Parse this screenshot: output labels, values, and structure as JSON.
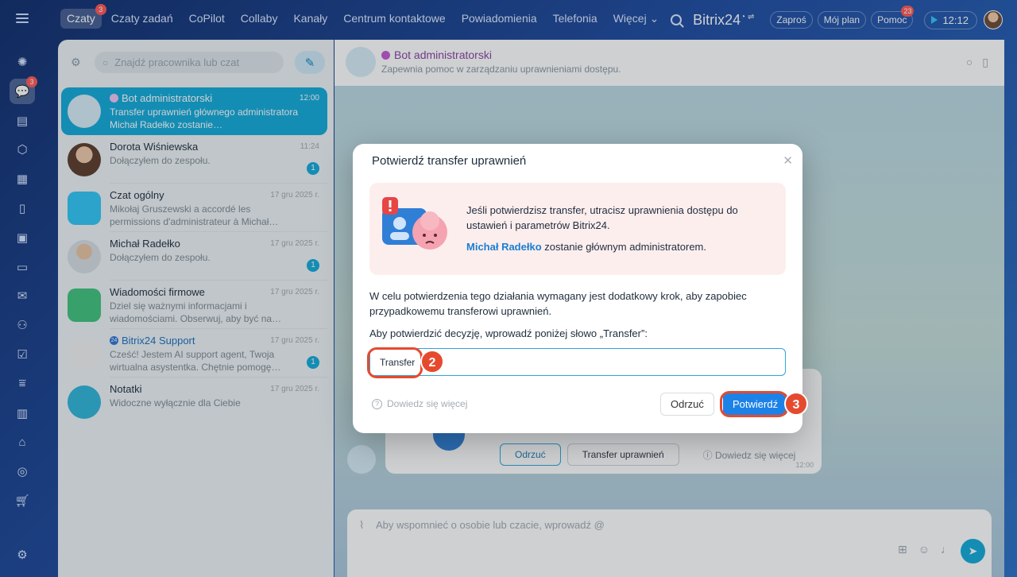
{
  "topbar": {
    "nav": [
      {
        "label": "Czaty",
        "badge": "3",
        "active": true
      },
      {
        "label": "Czaty zadań"
      },
      {
        "label": "CoPilot"
      },
      {
        "label": "Collaby"
      },
      {
        "label": "Kanały"
      },
      {
        "label": "Centrum kontaktowe"
      },
      {
        "label": "Powiadomienia"
      },
      {
        "label": "Telefonia"
      },
      {
        "label": "Więcej ⌄"
      }
    ],
    "brand": "Bitrix24",
    "invite_label": "Zaproś",
    "plan_label": "Mój plan",
    "help_label": "Pomoc",
    "help_badge": "23",
    "clock": "12:12"
  },
  "rail": {
    "chat_badge": "3"
  },
  "chatlist": {
    "search_placeholder": "Znajdź pracownika lub czat",
    "items": [
      {
        "name": "Bot administratorski",
        "time": "12:00",
        "preview": "Transfer uprawnień głównego administratora Michał Radełko zostanie…",
        "active": true
      },
      {
        "name": "Dorota Wiśniewska",
        "time": "11:24",
        "preview": "Dołączyłem do zespołu.",
        "count": "1"
      },
      {
        "name": "Czat ogólny",
        "time": "17 gru 2025 r.",
        "preview": "Mikołaj Gruszewski a accordé les permissions d'administrateur à Michał…"
      },
      {
        "name": "Michał Radełko",
        "time": "17 gru 2025 r.",
        "preview": "Dołączyłem do zespołu.",
        "count": "1"
      },
      {
        "name": "Wiadomości firmowe",
        "time": "17 gru 2025 r.",
        "preview": "Dziel się ważnymi informacjami i wiadomościami. Obserwuj, aby być na…"
      },
      {
        "name": "Bitrix24 Support",
        "time": "17 gru 2025 r.",
        "preview": "Cześć! Jestem AI support agent, Twoja wirtualna asystentka. Chętnie pomogę…",
        "count": "1"
      },
      {
        "name": "Notatki",
        "time": "17 gru 2025 r.",
        "preview": "Widoczne wyłącznie dla Ciebie"
      }
    ]
  },
  "chat": {
    "title": "Bot administratorski",
    "subtitle": "Zapewnia pomoc w zarządzaniu uprawnieniami dostępu.",
    "msg_reject": "Odrzuć",
    "msg_transfer": "Transfer uprawnień",
    "msg_learn_more": "Dowiedz się więcej",
    "msg_time": "12:00",
    "composer_placeholder": "Aby wspomnieć o osobie lub czacie, wprowadź @"
  },
  "modal": {
    "title": "Potwierdź transfer uprawnień",
    "warning": "Jeśli potwierdzisz transfer, utracisz uprawnienia dostępu do ustawień i parametrów Bitrix24.",
    "new_admin_name": "Michał Radełko",
    "new_admin_suffix": " zostanie głównym administratorem.",
    "paragraph": "W celu potwierdzenia tego działania wymagany jest dodatkowy krok, aby zapobiec przypadkowemu transferowi uprawnień.",
    "prompt": "Aby potwierdzić decyzję, wprowadź poniżej słowo „Transfer”:",
    "input_value": "Transfer",
    "help_link": "Dowiedz się więcej",
    "reject_label": "Odrzuć",
    "confirm_label": "Potwierdź"
  },
  "annotations": {
    "step_input": "2",
    "step_confirm": "3"
  },
  "colors": {
    "accent": "#11a9d9",
    "confirm": "#1d82e8",
    "annotation": "#e64a2e"
  }
}
